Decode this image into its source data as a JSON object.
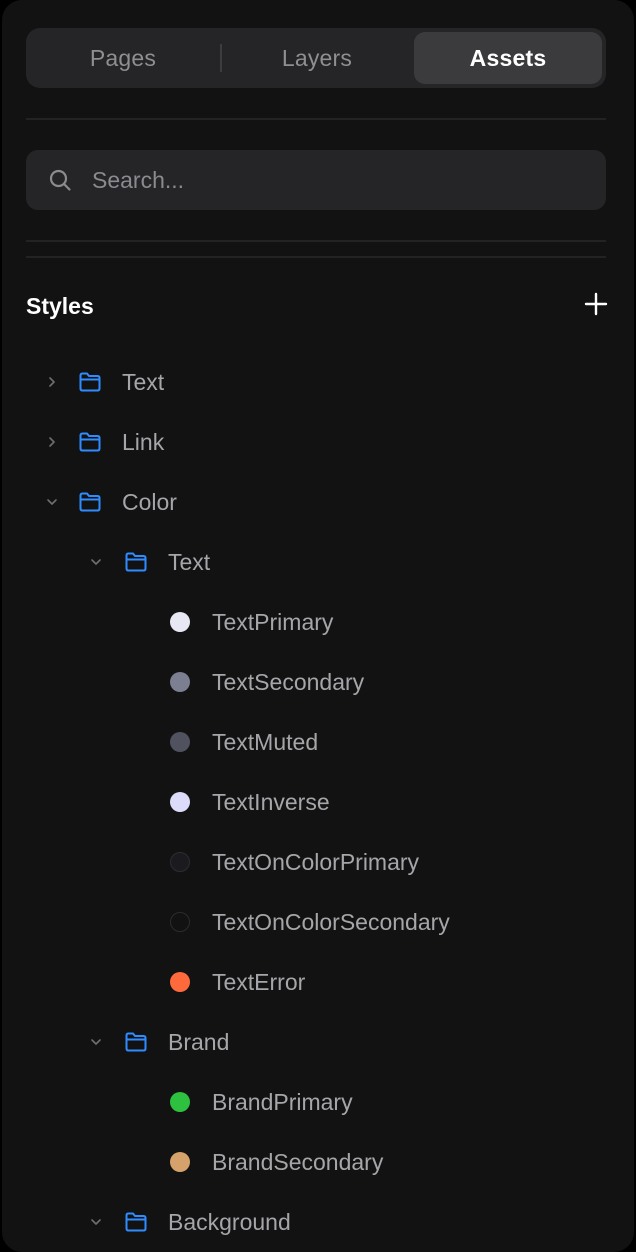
{
  "tabs": [
    {
      "label": "Pages",
      "active": false
    },
    {
      "label": "Layers",
      "active": false
    },
    {
      "label": "Assets",
      "active": true
    }
  ],
  "search": {
    "placeholder": "Search...",
    "value": ""
  },
  "styles": {
    "title": "Styles",
    "add_icon": "plus-icon",
    "tree": {
      "text_group": {
        "label": "Text",
        "expanded": false
      },
      "link_group": {
        "label": "Link",
        "expanded": false
      },
      "color_group": {
        "label": "Color",
        "expanded": true,
        "text": {
          "label": "Text",
          "expanded": true,
          "items": [
            {
              "label": "TextPrimary",
              "color": "#e8e8f4"
            },
            {
              "label": "TextSecondary",
              "color": "#7c7f91"
            },
            {
              "label": "TextMuted",
              "color": "#50525f"
            },
            {
              "label": "TextInverse",
              "color": "#dcdcfa"
            },
            {
              "label": "TextOnColorPrimary",
              "color": "#1a1a1f"
            },
            {
              "label": "TextOnColorSecondary",
              "color": "#121213"
            },
            {
              "label": "TextError",
              "color": "#ff6a3d"
            }
          ]
        },
        "brand": {
          "label": "Brand",
          "expanded": true,
          "items": [
            {
              "label": "BrandPrimary",
              "color": "#2ec13f"
            },
            {
              "label": "BrandSecondary",
              "color": "#d5a26c"
            }
          ]
        },
        "background": {
          "label": "Background",
          "expanded": true
        }
      }
    }
  },
  "colors": {
    "panel_bg": "#121213",
    "accent_folder": "#2f8cff",
    "text": "#a6a6aa"
  }
}
